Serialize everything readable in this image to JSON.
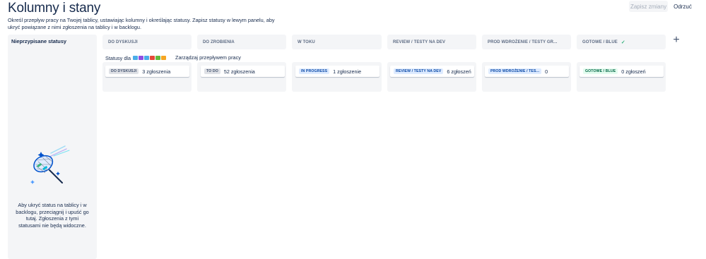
{
  "header": {
    "title": "Kolumny i stany",
    "save_label": "Zapisz zmiany",
    "discard_label": "Odrzuć"
  },
  "description": "Określ przepływ pracy na Twojej tablicy, ustawiając kolumny i określając statusy. Zapisz statusy w lewym panelu, aby ukryć powiązane z nimi zgłoszenia na tablicy i w backlogu.",
  "unassigned": {
    "title": "Nieprzypisane statusy",
    "hint": "Aby ukryć status na tablicy i w backlogu, przeciągnij i upuść go tutaj. Zgłoszenia z tymi statusami nie będą widoczne."
  },
  "statuses_for": {
    "label": "Statusy dla",
    "icons": [
      {
        "name": "task-icon",
        "color": "#4bade8"
      },
      {
        "name": "epic-icon",
        "color": "#904ee2"
      },
      {
        "name": "subtask-icon",
        "color": "#4bade8"
      },
      {
        "name": "bug-icon",
        "color": "#e5493a"
      },
      {
        "name": "story-icon",
        "color": "#63ba3c"
      },
      {
        "name": "improvement-icon",
        "color": "#f5a623"
      }
    ],
    "manage_label": "Zarządzaj przepływem pracy"
  },
  "columns": [
    {
      "header": "DO DYSKUSJI",
      "status": "DO DYSKUSJI",
      "status_color": "gray",
      "count": "3 zgłoszenia"
    },
    {
      "header": "DO ZROBIENIA",
      "status": "TO DO",
      "status_color": "gray",
      "count": "52 zgłoszenia"
    },
    {
      "header": "W TOKU",
      "status": "IN PROGRESS",
      "status_color": "blue",
      "count": "1 zgłoszenie"
    },
    {
      "header": "REVIEW / TESTY NA DEV",
      "status": "REVIEW / TESTY NA DEV",
      "status_color": "blue",
      "count": "6 zgłoszeń"
    },
    {
      "header": "PROD WDROŻENIE / TESTY GR...",
      "status": "PROD WDROŻENIE / TES...",
      "status_color": "blue",
      "count": "0"
    },
    {
      "header": "GOTOWE / BLUE",
      "header_check": "✓",
      "status": "GOTOWE / BLUE",
      "status_color": "green",
      "count": "0 zgłoszeń"
    }
  ],
  "add_column_icon": "plus-icon"
}
